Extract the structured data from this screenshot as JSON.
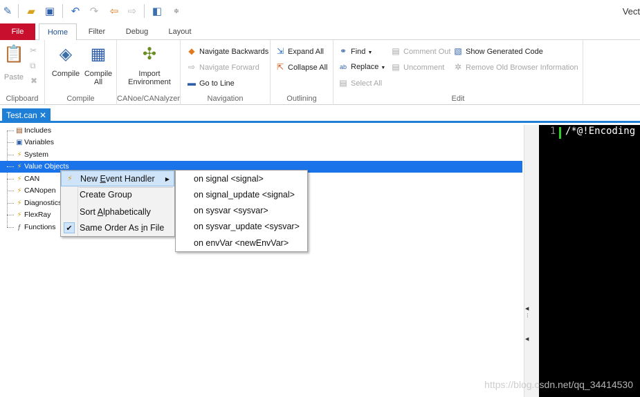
{
  "window": {
    "title": "Vect"
  },
  "quick_access": [
    "new-file-icon",
    "open-folder-icon",
    "save-icon",
    "undo-icon",
    "redo-icon",
    "back-icon",
    "forward-icon",
    "window-icon",
    "customize-icon"
  ],
  "ribbon_tabs": [
    {
      "label": "File"
    },
    {
      "label": "Home"
    },
    {
      "label": "Filter"
    },
    {
      "label": "Debug"
    },
    {
      "label": "Layout"
    }
  ],
  "ribbon": {
    "clipboard": {
      "label": "Clipboard",
      "paste": "Paste"
    },
    "compile": {
      "label": "Compile",
      "compile": "Compile",
      "compile_all_1": "Compile",
      "compile_all_2": "All"
    },
    "canoe": {
      "label": "CANoe/CANalyzer",
      "import_1": "Import",
      "import_2": "Environment"
    },
    "navigation": {
      "label": "Navigation",
      "back": "Navigate Backwards",
      "forward": "Navigate Forward",
      "goto": "Go to Line"
    },
    "outlining": {
      "label": "Outlining",
      "expand": "Expand All",
      "collapse": "Collapse All"
    },
    "edit": {
      "label": "Edit",
      "find": "Find",
      "replace": "Replace",
      "select_all": "Select All",
      "comment_out": "Comment Out",
      "uncomment": "Uncomment",
      "show_generated": "Show Generated Code",
      "remove_old": "Remove Old Browser Information"
    }
  },
  "document_tab": {
    "label": "Test.can",
    "close": "✕"
  },
  "tree": {
    "items": [
      {
        "label": "Includes"
      },
      {
        "label": "Variables"
      },
      {
        "label": "System"
      },
      {
        "label": "Value Objects"
      },
      {
        "label": "CAN"
      },
      {
        "label": "CANopen"
      },
      {
        "label": "Diagnostics"
      },
      {
        "label": "FlexRay"
      },
      {
        "label": "Functions"
      }
    ]
  },
  "editor": {
    "line_number": "1",
    "code": "/*@!Encoding"
  },
  "context_menu": {
    "new_event_handler_pre": "New ",
    "new_event_handler_u": "E",
    "new_event_handler_post": "vent Handler",
    "create_group": "Create Group",
    "sort_pre": "Sort ",
    "sort_u": "A",
    "sort_post": "lphabetically",
    "same_order_pre": "Same Order As ",
    "same_order_u": "i",
    "same_order_post": "n File"
  },
  "submenu": {
    "items": [
      {
        "label": "on signal <signal>"
      },
      {
        "label": "on signal_update <signal>"
      },
      {
        "label": "on sysvar <sysvar>"
      },
      {
        "label": "on sysvar_update <sysvar>"
      },
      {
        "label": "on envVar <newEnvVar>"
      }
    ]
  },
  "watermark": "https://blog.csdn.net/qq_34414530"
}
